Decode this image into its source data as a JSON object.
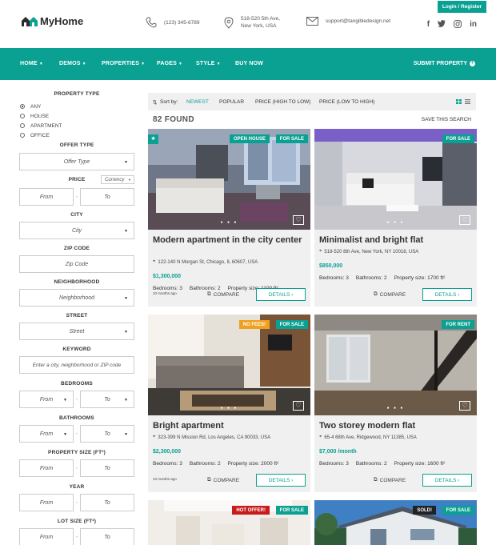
{
  "header": {
    "logo_text": "MyHome",
    "login": "Login / Register",
    "phone": "(123) 345-6789",
    "address_line1": "518-520 5th Ave,",
    "address_line2": "New York, USA",
    "email": "support@tangibledesign.net"
  },
  "nav": {
    "items": [
      "HOME",
      "DEMOS",
      "PROPERTIES",
      "PAGES",
      "STYLE",
      "BUY NOW"
    ],
    "submit": "SUBMIT PROPERTY"
  },
  "sidebar": {
    "property_type_title": "PROPERTY TYPE",
    "types": [
      "ANY",
      "HOUSE",
      "APARTMENT",
      "OFFICE"
    ],
    "offer_type_title": "OFFER TYPE",
    "offer_type_value": "Offer Type",
    "price_title": "PRICE",
    "currency": "Currency",
    "from": "From",
    "to": "To",
    "city_title": "CITY",
    "city_value": "City",
    "zip_title": "ZIP CODE",
    "zip_value": "Zip Code",
    "neighborhood_title": "NEIGHBORHOOD",
    "neighborhood_value": "Neighborhood",
    "street_title": "STREET",
    "street_value": "Street",
    "keyword_title": "KEYWORD",
    "keyword_placeholder": "Enter a city, neighborhood or ZIP code",
    "bedrooms_title": "BEDROOMS",
    "bathrooms_title": "BATHROOMS",
    "property_size_title": "PROPERTY SIZE (FT²)",
    "year_title": "YEAR",
    "lot_size_title": "LOT SIZE (FT²)"
  },
  "results": {
    "sort_by": "Sort by:",
    "sorts": [
      "NEWEST",
      "POPULAR",
      "PRICE (HIGH TO LOW)",
      "PRICE (LOW TO HIGH)"
    ],
    "found": "82 FOUND",
    "save_search": "SAVE THIS SEARCH",
    "compare": "COMPARE",
    "details": "DETAILS ›",
    "bedrooms_label": "Bedrooms:",
    "bathrooms_label": "Bathrooms:",
    "size_label": "Property size:",
    "cards": [
      {
        "title": "Modern apartment in the city center",
        "address": "122-140 N Morgan St, Chicago, IL 60607, USA",
        "price": "$1,300,000",
        "bedrooms": "3",
        "bathrooms": "2",
        "size": "1100 ft²",
        "date": "10 months ago",
        "badges": [
          "OPEN HOUSE",
          "FOR SALE"
        ]
      },
      {
        "title": "Minimalist and bright flat",
        "address": "518-520 8th Ave, New York, NY 10018, USA",
        "price": "$850,000",
        "bedrooms": "3",
        "bathrooms": "2",
        "size": "1700 ft²",
        "date": "",
        "badges": [
          "FOR SALE"
        ]
      },
      {
        "title": "Bright apartment",
        "address": "323-399 N Mission Rd, Los Angeles, CA 90033, USA",
        "price": "$2,300,000",
        "bedrooms": "3",
        "bathrooms": "2",
        "size": "2000 ft²",
        "date": "10 months ago",
        "badges": [
          "NO FEES!",
          "FOR SALE"
        ]
      },
      {
        "title": "Two storey modern flat",
        "address": "65-4 68th Ave, Ridgewood, NY 11385, USA",
        "price": "$7,000 /month",
        "bedrooms": "3",
        "bathrooms": "2",
        "size": "1600 ft²",
        "date": "",
        "badges": [
          "FOR RENT"
        ]
      },
      {
        "badges": [
          "HOT OFFER!",
          "FOR SALE"
        ]
      },
      {
        "badges": [
          "SOLD!",
          "FOR SALE"
        ]
      }
    ]
  },
  "colors": {
    "accent": "#0aa092",
    "orange": "#f0a01e",
    "red": "#c91b1b"
  }
}
